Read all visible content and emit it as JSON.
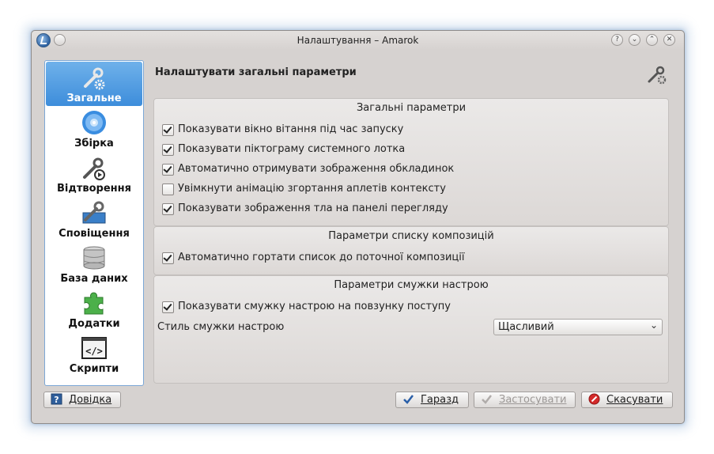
{
  "window": {
    "title": "Налаштування – Amarok",
    "controls": [
      "help",
      "minimize",
      "maximize",
      "close"
    ]
  },
  "sidebar": {
    "items": [
      {
        "label": "Загальне",
        "icon": "wrench-gear-icon",
        "active": true
      },
      {
        "label": "Збірка",
        "icon": "cd-icon",
        "active": false
      },
      {
        "label": "Відтворення",
        "icon": "wrench-play-icon",
        "active": false
      },
      {
        "label": "Сповіщення",
        "icon": "wrench-panel-icon",
        "active": false
      },
      {
        "label": "База даних",
        "icon": "database-icon",
        "active": false
      },
      {
        "label": "Додатки",
        "icon": "puzzle-icon",
        "active": false
      },
      {
        "label": "Скрипти",
        "icon": "script-icon",
        "active": false
      }
    ]
  },
  "main": {
    "title": "Налаштувати загальні параметри",
    "groups": [
      {
        "title": "Загальні параметри",
        "options": [
          {
            "label": "Показувати вікно вітання під час запуску",
            "checked": true
          },
          {
            "label": "Показувати піктограму системного лотка",
            "checked": true
          },
          {
            "label": "Автоматично отримувати зображення обкладинок",
            "checked": true
          },
          {
            "label": "Увімкнути анімацію згортання аплетів контексту",
            "checked": false
          },
          {
            "label": "Показувати зображення тла на панелі перегляду",
            "checked": true
          }
        ]
      },
      {
        "title": "Параметри списку композицій",
        "options": [
          {
            "label": "Автоматично гортати список до поточної композиції",
            "checked": true
          }
        ]
      },
      {
        "title": "Параметри смужки настрою",
        "options": [
          {
            "label": "Показувати смужку настрою на повзунку поступу",
            "checked": true
          }
        ],
        "style_label": "Стиль смужки настрою",
        "style_value": "Щасливий"
      }
    ]
  },
  "buttons": {
    "help": "Довідка",
    "ok": "Гаразд",
    "apply": "Застосувати",
    "cancel": "Скасувати"
  },
  "colors": {
    "selection": "#3d8ddb",
    "window_bg": "#d6d2d0"
  }
}
